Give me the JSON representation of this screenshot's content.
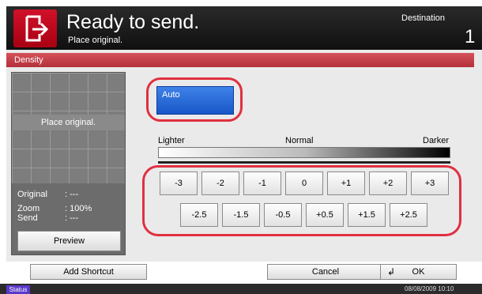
{
  "header": {
    "title": "Ready to send.",
    "subtitle": "Place original.",
    "destination_label": "Destination",
    "destination_count": "1",
    "icon": "send-icon"
  },
  "panel": {
    "title": "Density"
  },
  "preview": {
    "placeholder": "Place original.",
    "info": [
      {
        "label": "Original",
        "value": ": ---"
      },
      {
        "label": "Zoom",
        "value": ": 100%"
      },
      {
        "label": "Send",
        "value": ": ---"
      }
    ],
    "preview_button": "Preview"
  },
  "density": {
    "auto_label": "Auto",
    "scale": {
      "lighter": "Lighter",
      "normal": "Normal",
      "darker": "Darker"
    },
    "row1": [
      "-3",
      "-2",
      "-1",
      "0",
      "+1",
      "+2",
      "+3"
    ],
    "row2": [
      "-2.5",
      "-1.5",
      "-0.5",
      "+0.5",
      "+1.5",
      "+2.5"
    ]
  },
  "footer": {
    "add_shortcut": "Add Shortcut",
    "cancel": "Cancel",
    "ok": "OK",
    "ok_icon": "enter-icon"
  },
  "status_bar": {
    "status": "Status",
    "datetime": "08/08/2009   10:10"
  },
  "colors": {
    "accent_red": "#d1112a",
    "auto_blue": "#2a6ee0",
    "highlight_red": "#e03040"
  }
}
